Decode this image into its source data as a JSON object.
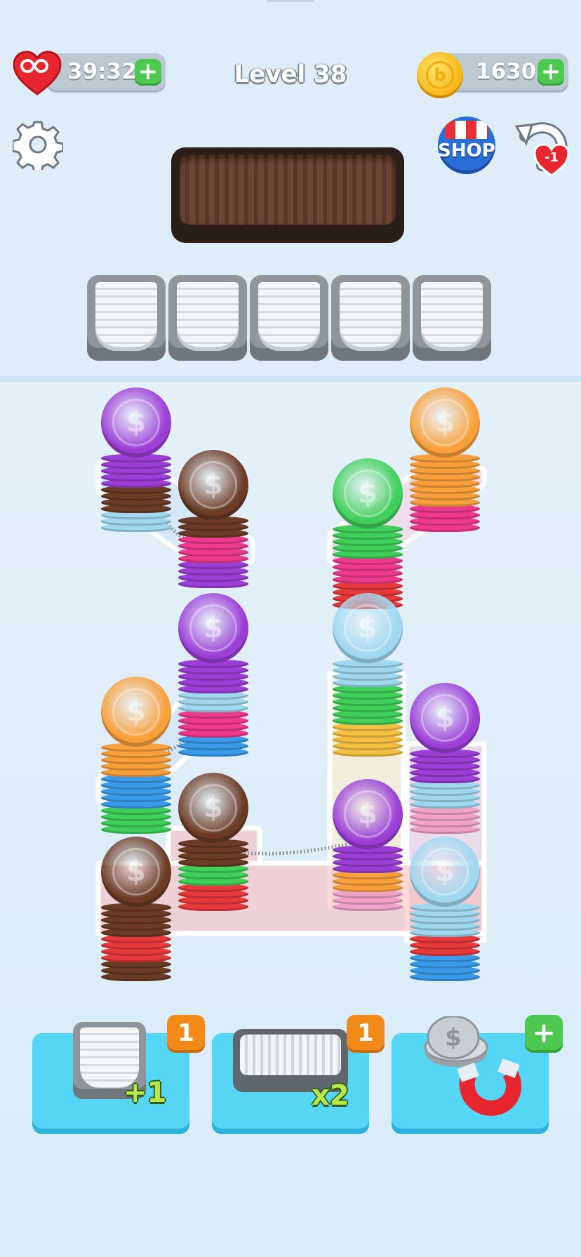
{
  "hud": {
    "lives_timer": "39:32",
    "level": "Level 38",
    "coins": "1630",
    "plus": "+"
  },
  "icons": {
    "lives": "heart-infinity-icon",
    "coins": "gold-coin-icon",
    "settings": "gear-icon",
    "shop": "shop-icon",
    "undo": "undo-icon"
  },
  "shop_label": "SHOP",
  "undo_cost": "-1",
  "coin_symbol": "$",
  "colors": {
    "purple": "#9b3fd6",
    "brown": "#6b3b26",
    "pink": "#ee3a8c",
    "orange": "#f8a03c",
    "green": "#3fcf5a",
    "red": "#e8393b",
    "lightblue": "#9fd8ef",
    "blue": "#3a9bea",
    "yellow": "#f5c042",
    "lightpink": "#f0a2c8"
  },
  "boosters": {
    "add_slot": {
      "label": "+1",
      "count": "1"
    },
    "double_tray": {
      "label": "x2",
      "count": "1"
    },
    "magnet": {
      "label": "+"
    }
  }
}
